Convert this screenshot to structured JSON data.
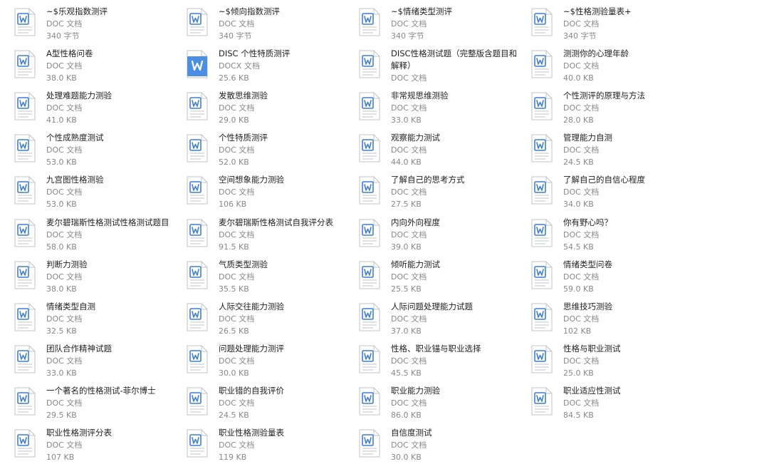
{
  "colors": {
    "accent": "#3f7fd8",
    "docx_fill": "#4b8ee6",
    "page_outline": "#bfc3c8",
    "name_text": "#222222",
    "meta_text": "#888888"
  },
  "icons": {
    "doc": "word-doc-icon",
    "docx": "word-docx-icon"
  },
  "files": [
    {
      "name": "~$乐观指数测评",
      "type": "DOC 文档",
      "size": "340 字节",
      "icon": "doc"
    },
    {
      "name": "~$倾向指数测评",
      "type": "DOC 文档",
      "size": "340 字节",
      "icon": "doc"
    },
    {
      "name": "~$情绪类型测评",
      "type": "DOC 文档",
      "size": "340 字节",
      "icon": "doc"
    },
    {
      "name": "~$性格测验量表+",
      "type": "DOC 文档",
      "size": "340 字节",
      "icon": "doc"
    },
    {
      "name": "A型性格问卷",
      "type": "DOC 文档",
      "size": "38.0 KB",
      "icon": "doc"
    },
    {
      "name": "DISC 个性特质测评",
      "type": "DOCX 文档",
      "size": "25.6 KB",
      "icon": "docx"
    },
    {
      "name": "DISC性格测试题（完整版含题目和解释）",
      "type": "DOC 文档",
      "size": "",
      "icon": "doc",
      "wrap": true
    },
    {
      "name": "测测你的心理年龄",
      "type": "DOC 文档",
      "size": "40.0 KB",
      "icon": "doc"
    },
    {
      "name": "处理难题能力测验",
      "type": "DOC 文档",
      "size": "41.0 KB",
      "icon": "doc"
    },
    {
      "name": "发散思维测验",
      "type": "DOC 文档",
      "size": "29.0 KB",
      "icon": "doc"
    },
    {
      "name": "非常规思维测验",
      "type": "DOC 文档",
      "size": "33.0 KB",
      "icon": "doc"
    },
    {
      "name": "个性测评的原理与方法",
      "type": "DOC 文档",
      "size": "28.0 KB",
      "icon": "doc"
    },
    {
      "name": "个性成熟度测试",
      "type": "DOC 文档",
      "size": "53.0 KB",
      "icon": "doc"
    },
    {
      "name": "个性特质测评",
      "type": "DOC 文档",
      "size": "52.0 KB",
      "icon": "doc"
    },
    {
      "name": "观察能力测试",
      "type": "DOC 文档",
      "size": "44.0 KB",
      "icon": "doc"
    },
    {
      "name": "管理能力自测",
      "type": "DOC 文档",
      "size": "24.5 KB",
      "icon": "doc"
    },
    {
      "name": "九宫图性格测验",
      "type": "DOC 文档",
      "size": "53.0 KB",
      "icon": "doc"
    },
    {
      "name": "空间想象能力测验",
      "type": "DOC 文档",
      "size": "106 KB",
      "icon": "doc"
    },
    {
      "name": "了解自己的思考方式",
      "type": "DOC 文档",
      "size": "27.5 KB",
      "icon": "doc"
    },
    {
      "name": "了解自己的自信心程度",
      "type": "DOC 文档",
      "size": "34.0 KB",
      "icon": "doc"
    },
    {
      "name": "麦尔碧瑞斯性格测试性格测试题目",
      "type": "DOC 文档",
      "size": "58.0 KB",
      "icon": "doc"
    },
    {
      "name": "麦尔碧瑞斯性格测试自我评分表",
      "type": "DOC 文档",
      "size": "91.5 KB",
      "icon": "doc"
    },
    {
      "name": "内向外向程度",
      "type": "DOC 文档",
      "size": "39.0 KB",
      "icon": "doc"
    },
    {
      "name": "你有野心吗？",
      "type": "DOC 文档",
      "size": "54.5 KB",
      "icon": "doc"
    },
    {
      "name": "判断力测验",
      "type": "DOC 文档",
      "size": "38.0 KB",
      "icon": "doc"
    },
    {
      "name": "气质类型测验",
      "type": "DOC 文档",
      "size": "35.5 KB",
      "icon": "doc"
    },
    {
      "name": "倾听能力测试",
      "type": "DOC 文档",
      "size": "25.5 KB",
      "icon": "doc"
    },
    {
      "name": "情绪类型问卷",
      "type": "DOC 文档",
      "size": "59.0 KB",
      "icon": "doc"
    },
    {
      "name": "情绪类型自测",
      "type": "DOC 文档",
      "size": "32.5 KB",
      "icon": "doc"
    },
    {
      "name": "人际交往能力测验",
      "type": "DOC 文档",
      "size": "26.5 KB",
      "icon": "doc"
    },
    {
      "name": "人际问题处理能力试题",
      "type": "DOC 文档",
      "size": "37.0 KB",
      "icon": "doc"
    },
    {
      "name": "思维技巧测验",
      "type": "DOC 文档",
      "size": "102 KB",
      "icon": "doc"
    },
    {
      "name": "团队合作精神试题",
      "type": "DOC 文档",
      "size": "33.0 KB",
      "icon": "doc"
    },
    {
      "name": "问题处理能力测评",
      "type": "DOC 文档",
      "size": "30.0 KB",
      "icon": "doc"
    },
    {
      "name": "性格、职业锚与职业选择",
      "type": "DOC 文档",
      "size": "45.5 KB",
      "icon": "doc"
    },
    {
      "name": "性格与职业测试",
      "type": "DOC 文档",
      "size": "25.0 KB",
      "icon": "doc"
    },
    {
      "name": "一个著名的性格测试-菲尔博士",
      "type": "DOC 文档",
      "size": "29.5 KB",
      "icon": "doc"
    },
    {
      "name": "职业错的自我评价",
      "type": "DOC 文档",
      "size": "24.5 KB",
      "icon": "doc"
    },
    {
      "name": "职业能力测验",
      "type": "DOC 文档",
      "size": "86.0 KB",
      "icon": "doc"
    },
    {
      "name": "职业适应性测试",
      "type": "DOC 文档",
      "size": "84.5 KB",
      "icon": "doc"
    },
    {
      "name": "职业性格测评分表",
      "type": "DOC 文档",
      "size": "107 KB",
      "icon": "doc"
    },
    {
      "name": "职业性格测验量表",
      "type": "DOC 文档",
      "size": "119 KB",
      "icon": "doc"
    },
    {
      "name": "自信度测试",
      "type": "DOC 文档",
      "size": "30.0 KB",
      "icon": "doc"
    }
  ]
}
